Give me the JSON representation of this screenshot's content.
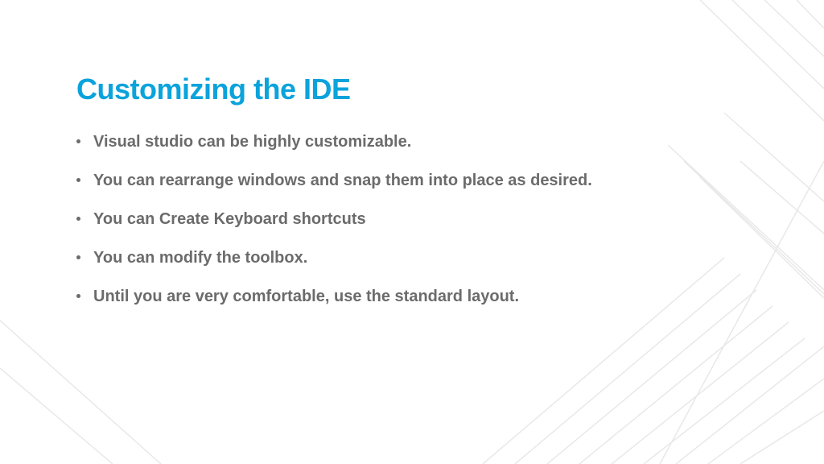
{
  "slide": {
    "title": "Customizing the IDE",
    "bullets": [
      "Visual studio can be highly customizable.",
      "You can rearrange windows and snap them into place as desired.",
      "You can Create Keyboard shortcuts",
      "You can modify the toolbox.",
      "Until you are very comfortable, use the standard layout."
    ]
  },
  "colors": {
    "title": "#0aa3db",
    "text": "#6b6b6b"
  }
}
